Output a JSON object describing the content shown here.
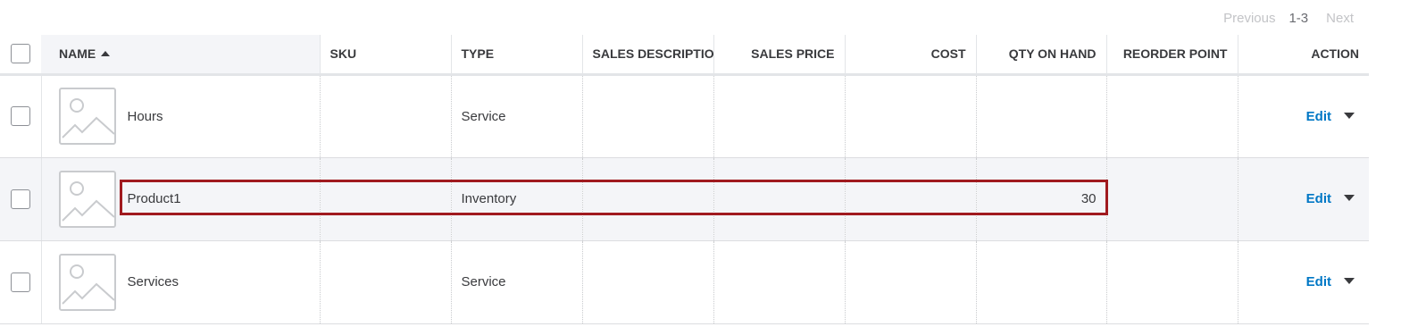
{
  "pagination": {
    "previous": "Previous",
    "range": "1-3",
    "next": "Next"
  },
  "columns": {
    "name": "NAME",
    "sku": "SKU",
    "type": "TYPE",
    "sales_description": "SALES DESCRIPTION",
    "sales_price": "SALES PRICE",
    "cost": "COST",
    "qty_on_hand": "QTY ON HAND",
    "reorder_point": "REORDER POINT",
    "action": "ACTION"
  },
  "sort": {
    "column": "name",
    "direction": "ascending",
    "icon": "sort-ascending-icon"
  },
  "rows": [
    {
      "name": "Hours",
      "sku": "",
      "type": "Service",
      "sales_description": "",
      "sales_price": "",
      "cost": "",
      "qty_on_hand": "",
      "reorder_point": "",
      "action": "Edit",
      "thumbnail_icon": "image-placeholder-icon"
    },
    {
      "name": "Product1",
      "sku": "",
      "type": "Inventory",
      "sales_description": "",
      "sales_price": "",
      "cost": "",
      "qty_on_hand": "30",
      "reorder_point": "",
      "action": "Edit",
      "thumbnail_icon": "image-placeholder-icon"
    },
    {
      "name": "Services",
      "sku": "",
      "type": "Service",
      "sales_description": "",
      "sales_price": "",
      "cost": "",
      "qty_on_hand": "",
      "reorder_point": "",
      "action": "Edit",
      "thumbnail_icon": "image-placeholder-icon"
    }
  ],
  "highlighted_row": 1,
  "colors": {
    "link": "#0077c5",
    "annotation": "#a01a1f",
    "header_bg": "#f4f5f8",
    "text": "#393a3d"
  }
}
